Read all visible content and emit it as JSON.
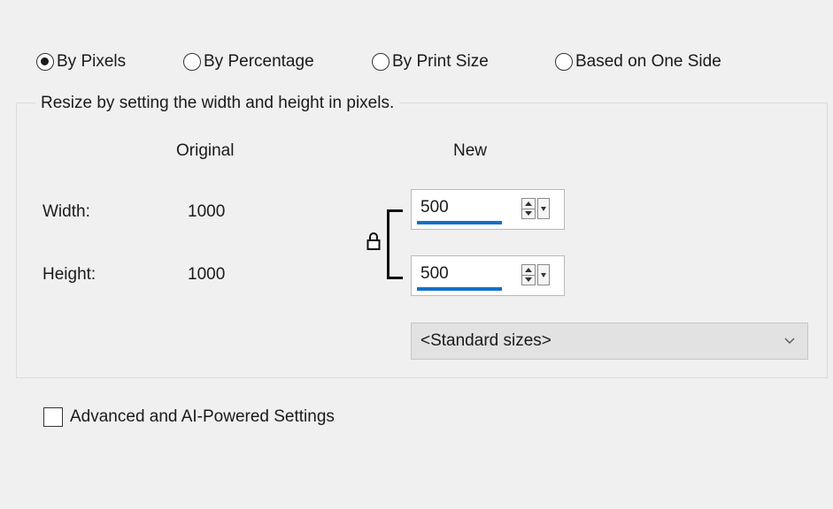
{
  "resize_mode": {
    "options": [
      {
        "label": "By Pixels",
        "checked": true
      },
      {
        "label": "By Percentage",
        "checked": false
      },
      {
        "label": "By Print Size",
        "checked": false
      },
      {
        "label": "Based on One Side",
        "checked": false
      }
    ]
  },
  "group": {
    "legend": "Resize by setting the width and height in pixels.",
    "original_header": "Original",
    "new_header": "New",
    "width_label": "Width:",
    "height_label": "Height:",
    "original_width": "1000",
    "original_height": "1000",
    "new_width": "500",
    "new_height": "500",
    "aspect_lock_icon": "lock-icon",
    "standard_sizes": "<Standard sizes>"
  },
  "advanced": {
    "label": "Advanced and AI-Powered Settings",
    "checked": false
  },
  "colors": {
    "background": "#f0f0f0",
    "accent_underline": "#1170c9",
    "dropdown_bg": "#e2e2e2"
  }
}
